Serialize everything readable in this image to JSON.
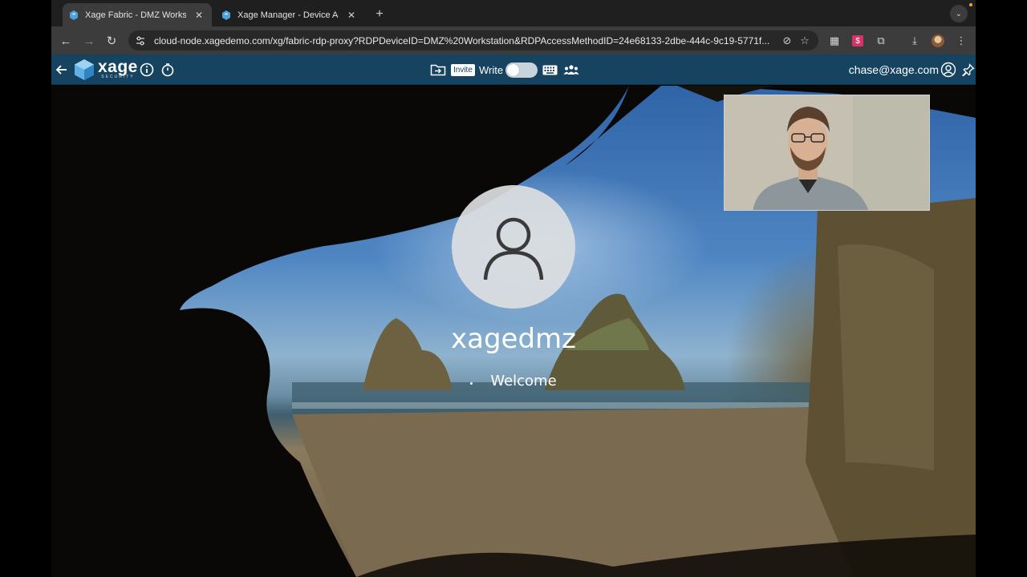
{
  "browser": {
    "tabs": [
      {
        "title": "Xage Fabric - DMZ Workstation",
        "active": true
      },
      {
        "title": "Xage Manager - Device Access",
        "active": false
      }
    ],
    "new_tab_label": "+",
    "url": "cloud-node.xagedemo.com/xg/fabric-rdp-proxy?RDPDeviceID=DMZ%20Workstation&RDPAccessMethodID=24e68133-2dbe-444c-9c19-5771f..."
  },
  "app_header": {
    "logo_text": "xage",
    "logo_subtext": "SECURITY",
    "invite_label": "Invite",
    "write_label": "Write",
    "write_enabled": false,
    "user_email": "chase@xage.com"
  },
  "remote_desktop": {
    "user_name": "xagedmz",
    "status_text": "Welcome"
  },
  "colors": {
    "app_header_bg": "#154360",
    "browser_chrome": "#3c3c3c",
    "tab_strip": "#1f1f1f",
    "xage_blue": "#4aa3df"
  }
}
